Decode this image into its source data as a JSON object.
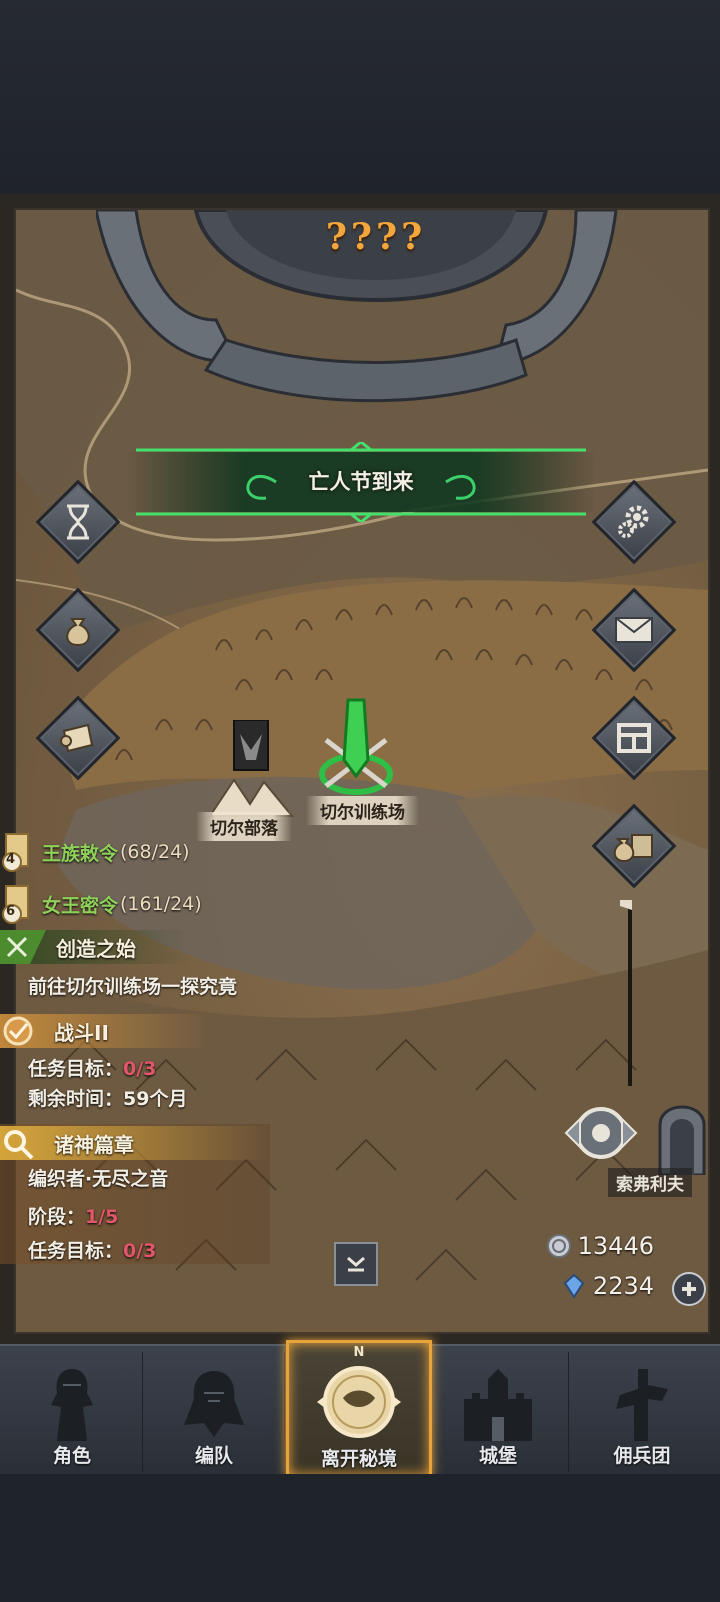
{
  "map_title": "????",
  "banner": {
    "text": "亡人节到来"
  },
  "locations": {
    "training_ground": "切尔训练场",
    "tribe": "切尔部落",
    "city_partial": "索弗利夫"
  },
  "quests": {
    "royal_decree": {
      "icon_number": "4",
      "title": "王族敕令",
      "count": "(68/24)"
    },
    "queen_secret": {
      "icon_number": "6",
      "title": "女王密令",
      "count": "(161/24)"
    },
    "creation": {
      "title": "创造之始",
      "desc": "前往切尔训练场一探究竟"
    },
    "battle": {
      "title": "战斗II",
      "goal_label": "任务目标：",
      "goal_value": "0/3",
      "time_label": "剩余时间：",
      "time_value": "59个月"
    },
    "gods": {
      "title": "诸神篇章",
      "subtitle": "编织者·无尽之音",
      "stage_label": "阶段：",
      "stage_value": "1/5",
      "goal_label": "任务目标：",
      "goal_value": "0/3"
    }
  },
  "resources": {
    "silver": "13446",
    "crystal": "2234"
  },
  "nav": {
    "items": [
      {
        "label": "角色"
      },
      {
        "label": "编队"
      },
      {
        "label": "离开秘境"
      },
      {
        "label": "城堡"
      },
      {
        "label": "佣兵团"
      }
    ],
    "compass_letter": "N"
  },
  "colors": {
    "accent_gold": "#e8a43a",
    "quest_green": "#8fd05a",
    "banner_green": "#3cd06a",
    "progress_red": "#e0566a"
  }
}
